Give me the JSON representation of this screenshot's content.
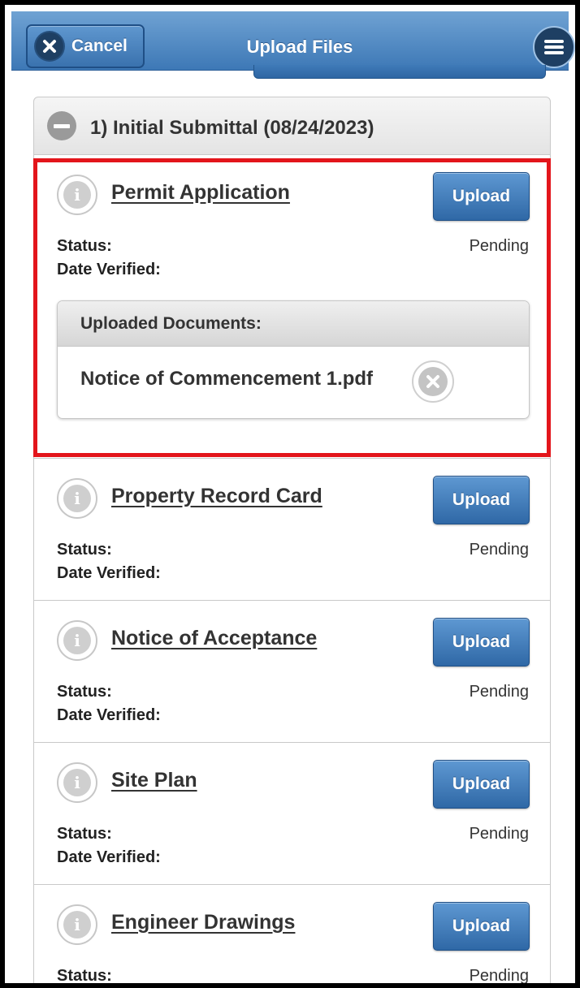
{
  "header": {
    "cancel_label": "Cancel",
    "title": "Upload Files"
  },
  "section": {
    "title": "1) Initial Submittal (08/24/2023)"
  },
  "labels": {
    "status": "Status:",
    "date_verified": "Date Verified:",
    "upload": "Upload",
    "uploaded_documents": "Uploaded Documents:"
  },
  "items": [
    {
      "title": "Permit Application",
      "status": "Pending",
      "documents": [
        "Notice of Commencement 1.pdf"
      ]
    },
    {
      "title": "Property Record Card",
      "status": "Pending"
    },
    {
      "title": "Notice of Acceptance",
      "status": "Pending"
    },
    {
      "title": "Site Plan",
      "status": "Pending"
    },
    {
      "title": "Engineer Drawings",
      "status": "Pending"
    }
  ],
  "colors": {
    "header_blue": "#4a84c0",
    "highlight_red": "#e3151b"
  }
}
